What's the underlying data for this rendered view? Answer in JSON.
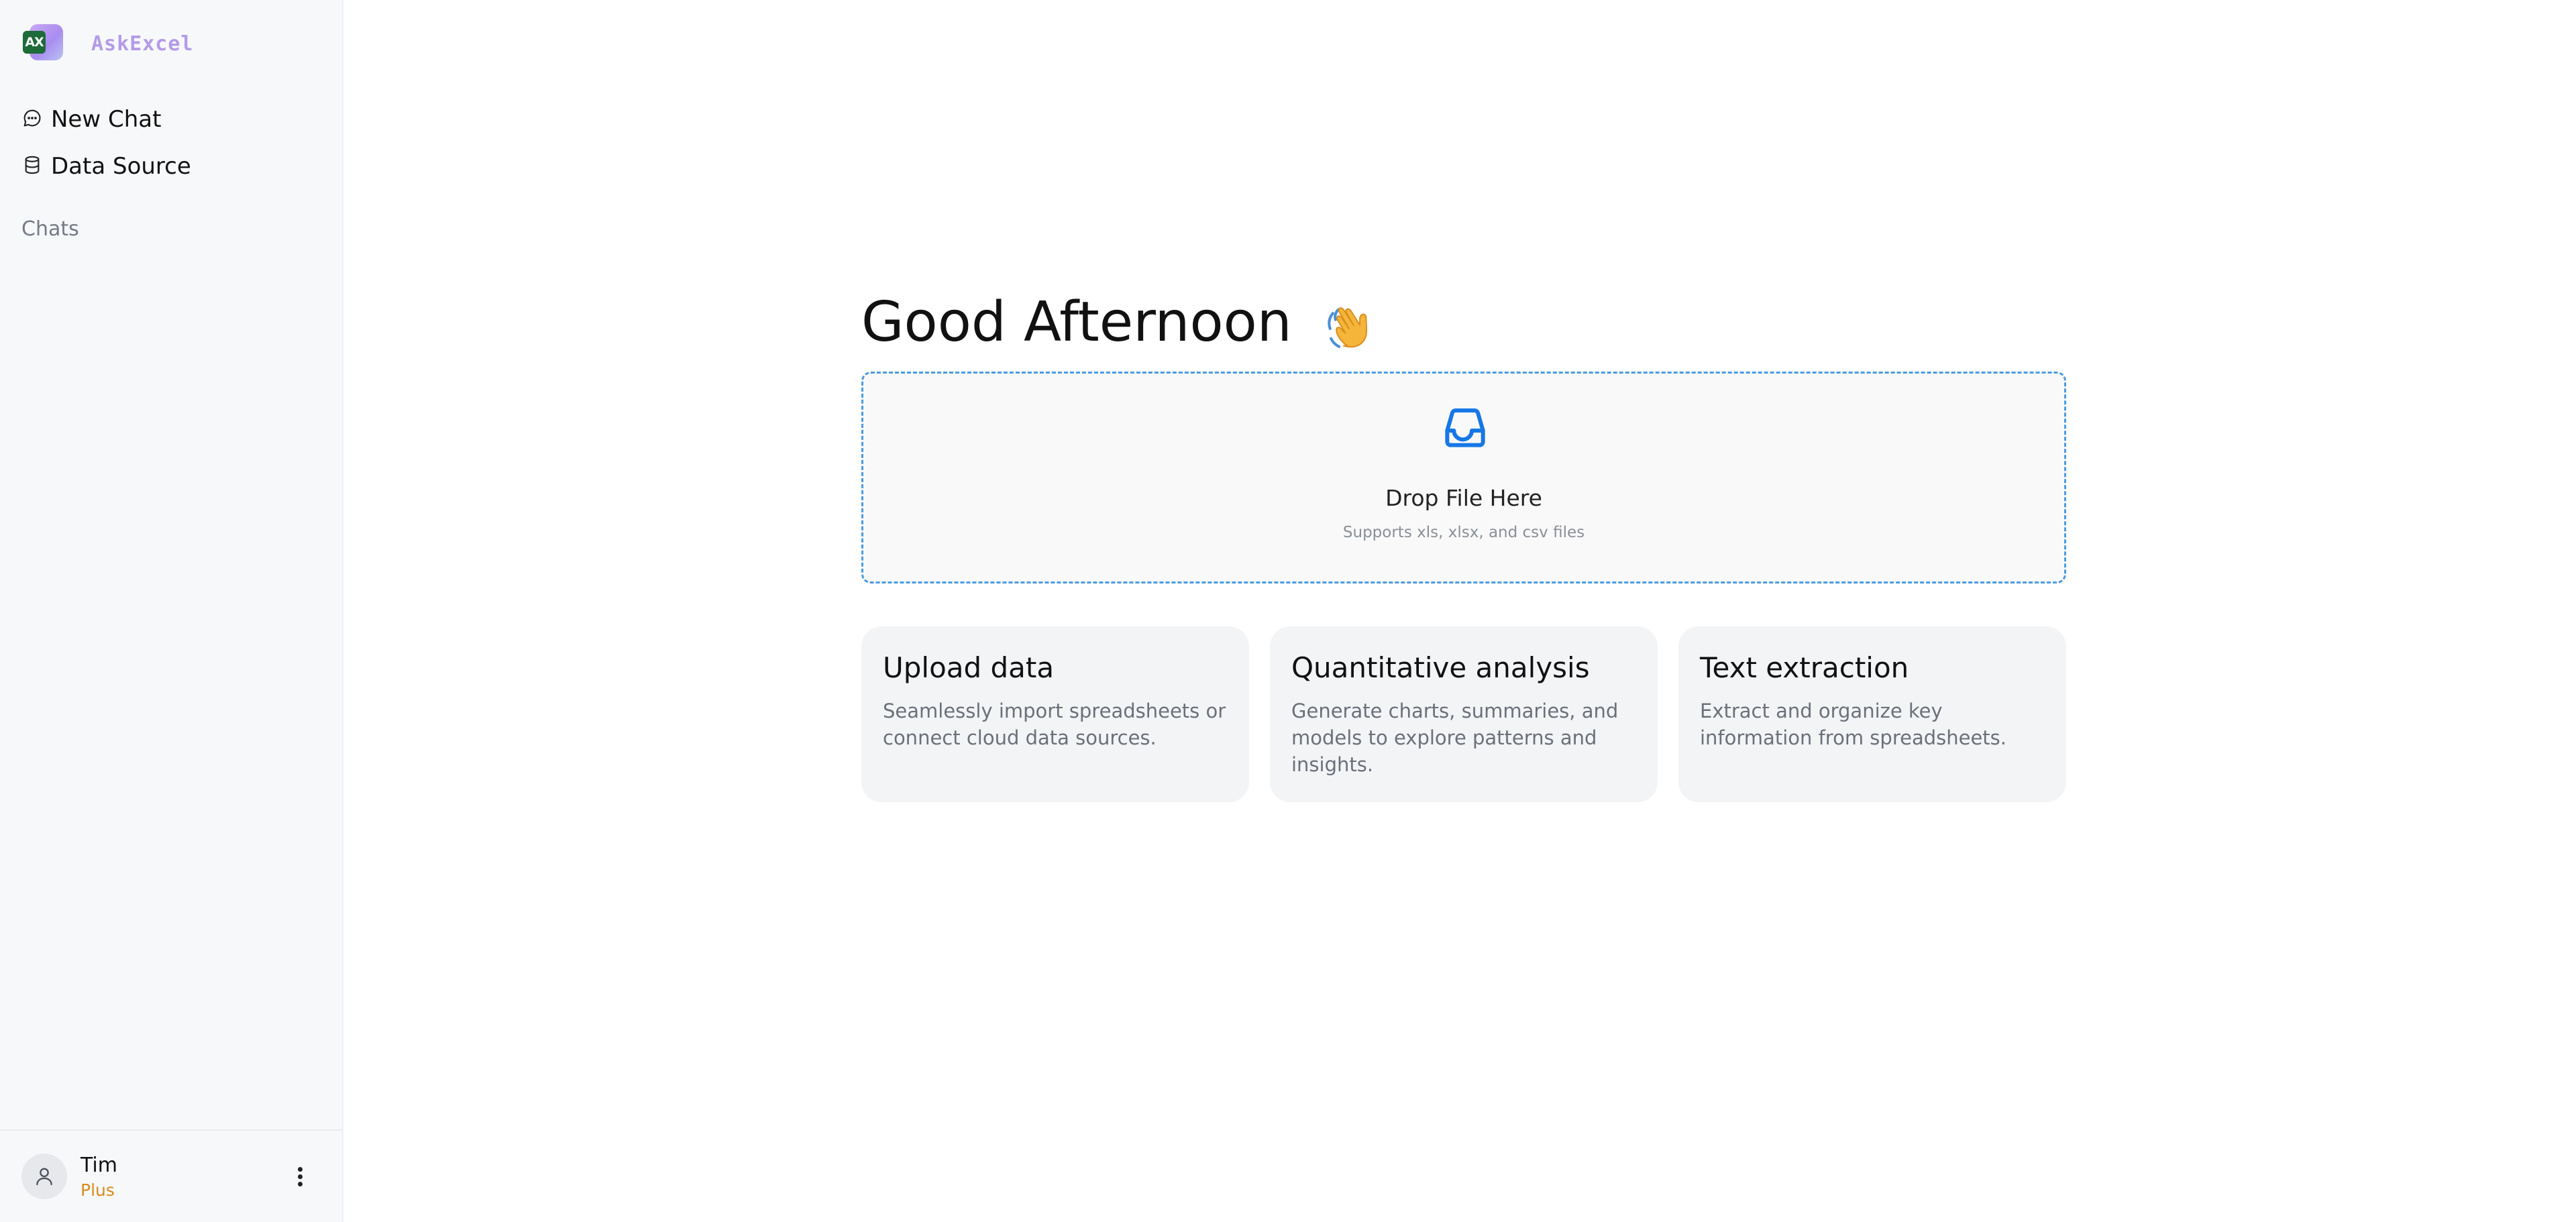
{
  "app": {
    "name": "AskExcel",
    "logo_mark": "AX"
  },
  "sidebar": {
    "nav": [
      {
        "label": "New Chat",
        "icon": "chat-bubble-icon"
      },
      {
        "label": "Data Source",
        "icon": "database-icon"
      }
    ],
    "section_label": "Chats"
  },
  "user": {
    "name": "Tim",
    "plan": "Plus",
    "menu_icon": "more-vertical-icon"
  },
  "main": {
    "greeting": "Good Afternoon",
    "greeting_emoji": "waving-hand-icon",
    "dropzone": {
      "icon": "inbox-icon",
      "title": "Drop File Here",
      "hint": "Supports xls, xlsx, and csv files"
    },
    "cards": [
      {
        "title": "Upload data",
        "description": "Seamlessly import spreadsheets or connect cloud data sources."
      },
      {
        "title": "Quantitative analysis",
        "description": "Generate charts, summaries, and models to explore patterns and insights."
      },
      {
        "title": "Text extraction",
        "description": "Extract and organize key information from spreadsheets."
      }
    ]
  },
  "colors": {
    "sidebar_bg": "#f7f8fa",
    "brand_text": "#b49be8",
    "plan_accent": "#d98a1c",
    "dropzone_border": "#4b9be2",
    "card_bg": "#f3f4f6"
  }
}
